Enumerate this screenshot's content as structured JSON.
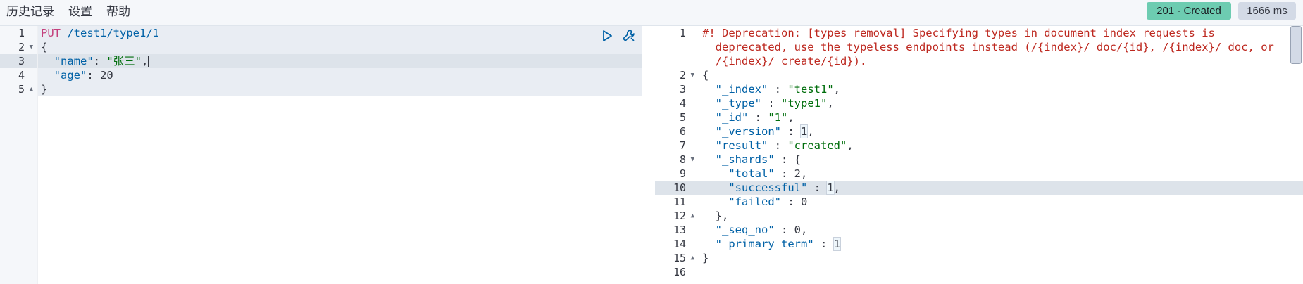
{
  "menu": {
    "history": "历史记录",
    "settings": "设置",
    "help": "帮助"
  },
  "status": {
    "code": "201 - Created",
    "time": "1666 ms"
  },
  "colors": {
    "status_ok": "#6dccb1",
    "time_badge": "#d3dae6",
    "warning": "#bd271e",
    "string": "#006e0c",
    "key": "#0061a6",
    "method": "#c4407c"
  },
  "request": {
    "line_numbers": [
      "1",
      "2",
      "3",
      "4",
      "5"
    ],
    "method": "PUT",
    "url": " /test1/type1/1",
    "open_brace": "{",
    "name_key": "\"name\"",
    "name_sep": ": ",
    "name_val": "\"张三\"",
    "name_comma": ",",
    "age_key": "\"age\"",
    "age_sep": ": ",
    "age_val": "20",
    "close_brace": "}",
    "actions": {
      "run_icon": "play-icon",
      "copy_icon": "wrench-icon"
    }
  },
  "response": {
    "line_numbers": [
      "1",
      "",
      "",
      "2",
      "3",
      "4",
      "5",
      "6",
      "7",
      "8",
      "9",
      "10",
      "11",
      "12",
      "13",
      "14",
      "15",
      "16"
    ],
    "warning_1": "#! Deprecation: [types removal] Specifying types in document index requests is",
    "warning_2": "  deprecated, use the typeless endpoints instead (/{index}/_doc/{id}, /{index}/_doc, or",
    "warning_3": "  /{index}/_create/{id}).",
    "open_brace": "{",
    "index_key": "\"_index\"",
    "index_val": "\"test1\"",
    "type_key": "\"_type\"",
    "type_val": "\"type1\"",
    "id_key": "\"_id\"",
    "id_val": "\"1\"",
    "version_key": "\"_version\"",
    "version_val": "1",
    "result_key": "\"result\"",
    "result_val": "\"created\"",
    "shards_key": "\"_shards\"",
    "total_key": "\"total\"",
    "total_val": "2",
    "successful_key": "\"successful\"",
    "successful_val": "1",
    "failed_key": "\"failed\"",
    "failed_val": "0",
    "shards_close": "},",
    "seq_key": "\"_seq_no\"",
    "seq_val": "0",
    "term_key": "\"_primary_term\"",
    "term_val": "1",
    "close_brace": "}"
  }
}
